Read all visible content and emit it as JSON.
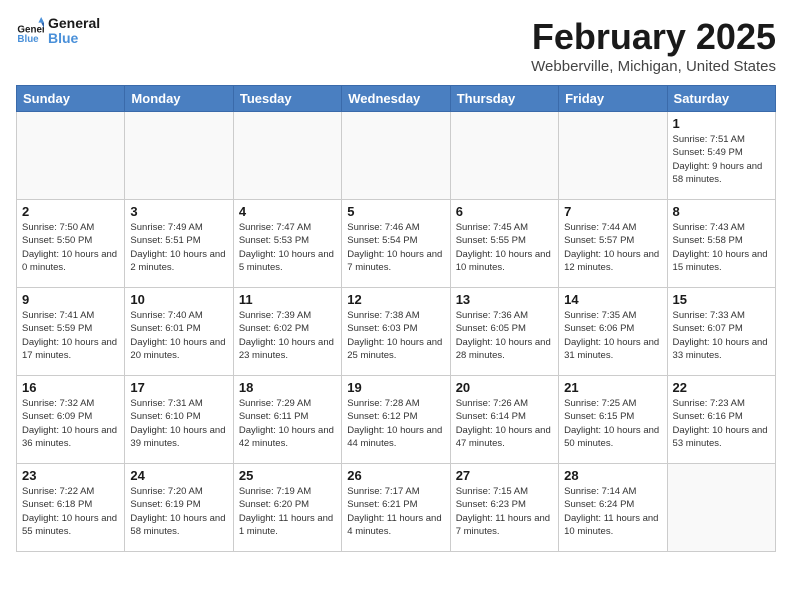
{
  "header": {
    "logo_line1": "General",
    "logo_line2": "Blue",
    "title": "February 2025",
    "subtitle": "Webberville, Michigan, United States"
  },
  "weekdays": [
    "Sunday",
    "Monday",
    "Tuesday",
    "Wednesday",
    "Thursday",
    "Friday",
    "Saturday"
  ],
  "weeks": [
    [
      {
        "day": "",
        "info": ""
      },
      {
        "day": "",
        "info": ""
      },
      {
        "day": "",
        "info": ""
      },
      {
        "day": "",
        "info": ""
      },
      {
        "day": "",
        "info": ""
      },
      {
        "day": "",
        "info": ""
      },
      {
        "day": "1",
        "info": "Sunrise: 7:51 AM\nSunset: 5:49 PM\nDaylight: 9 hours and 58 minutes."
      }
    ],
    [
      {
        "day": "2",
        "info": "Sunrise: 7:50 AM\nSunset: 5:50 PM\nDaylight: 10 hours and 0 minutes."
      },
      {
        "day": "3",
        "info": "Sunrise: 7:49 AM\nSunset: 5:51 PM\nDaylight: 10 hours and 2 minutes."
      },
      {
        "day": "4",
        "info": "Sunrise: 7:47 AM\nSunset: 5:53 PM\nDaylight: 10 hours and 5 minutes."
      },
      {
        "day": "5",
        "info": "Sunrise: 7:46 AM\nSunset: 5:54 PM\nDaylight: 10 hours and 7 minutes."
      },
      {
        "day": "6",
        "info": "Sunrise: 7:45 AM\nSunset: 5:55 PM\nDaylight: 10 hours and 10 minutes."
      },
      {
        "day": "7",
        "info": "Sunrise: 7:44 AM\nSunset: 5:57 PM\nDaylight: 10 hours and 12 minutes."
      },
      {
        "day": "8",
        "info": "Sunrise: 7:43 AM\nSunset: 5:58 PM\nDaylight: 10 hours and 15 minutes."
      }
    ],
    [
      {
        "day": "9",
        "info": "Sunrise: 7:41 AM\nSunset: 5:59 PM\nDaylight: 10 hours and 17 minutes."
      },
      {
        "day": "10",
        "info": "Sunrise: 7:40 AM\nSunset: 6:01 PM\nDaylight: 10 hours and 20 minutes."
      },
      {
        "day": "11",
        "info": "Sunrise: 7:39 AM\nSunset: 6:02 PM\nDaylight: 10 hours and 23 minutes."
      },
      {
        "day": "12",
        "info": "Sunrise: 7:38 AM\nSunset: 6:03 PM\nDaylight: 10 hours and 25 minutes."
      },
      {
        "day": "13",
        "info": "Sunrise: 7:36 AM\nSunset: 6:05 PM\nDaylight: 10 hours and 28 minutes."
      },
      {
        "day": "14",
        "info": "Sunrise: 7:35 AM\nSunset: 6:06 PM\nDaylight: 10 hours and 31 minutes."
      },
      {
        "day": "15",
        "info": "Sunrise: 7:33 AM\nSunset: 6:07 PM\nDaylight: 10 hours and 33 minutes."
      }
    ],
    [
      {
        "day": "16",
        "info": "Sunrise: 7:32 AM\nSunset: 6:09 PM\nDaylight: 10 hours and 36 minutes."
      },
      {
        "day": "17",
        "info": "Sunrise: 7:31 AM\nSunset: 6:10 PM\nDaylight: 10 hours and 39 minutes."
      },
      {
        "day": "18",
        "info": "Sunrise: 7:29 AM\nSunset: 6:11 PM\nDaylight: 10 hours and 42 minutes."
      },
      {
        "day": "19",
        "info": "Sunrise: 7:28 AM\nSunset: 6:12 PM\nDaylight: 10 hours and 44 minutes."
      },
      {
        "day": "20",
        "info": "Sunrise: 7:26 AM\nSunset: 6:14 PM\nDaylight: 10 hours and 47 minutes."
      },
      {
        "day": "21",
        "info": "Sunrise: 7:25 AM\nSunset: 6:15 PM\nDaylight: 10 hours and 50 minutes."
      },
      {
        "day": "22",
        "info": "Sunrise: 7:23 AM\nSunset: 6:16 PM\nDaylight: 10 hours and 53 minutes."
      }
    ],
    [
      {
        "day": "23",
        "info": "Sunrise: 7:22 AM\nSunset: 6:18 PM\nDaylight: 10 hours and 55 minutes."
      },
      {
        "day": "24",
        "info": "Sunrise: 7:20 AM\nSunset: 6:19 PM\nDaylight: 10 hours and 58 minutes."
      },
      {
        "day": "25",
        "info": "Sunrise: 7:19 AM\nSunset: 6:20 PM\nDaylight: 11 hours and 1 minute."
      },
      {
        "day": "26",
        "info": "Sunrise: 7:17 AM\nSunset: 6:21 PM\nDaylight: 11 hours and 4 minutes."
      },
      {
        "day": "27",
        "info": "Sunrise: 7:15 AM\nSunset: 6:23 PM\nDaylight: 11 hours and 7 minutes."
      },
      {
        "day": "28",
        "info": "Sunrise: 7:14 AM\nSunset: 6:24 PM\nDaylight: 11 hours and 10 minutes."
      },
      {
        "day": "",
        "info": ""
      }
    ]
  ]
}
